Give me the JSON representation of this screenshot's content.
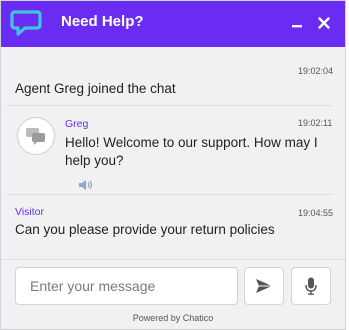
{
  "header": {
    "title": "Need Help?"
  },
  "chat": {
    "system_time": "19:02:04",
    "system_message": "Agent Greg joined the chat",
    "agent": {
      "name": "Greg",
      "time": "19:02:11",
      "message": "Hello! Welcome to our support. How may I help you?"
    },
    "visitor": {
      "name": "Visitor",
      "time": "19:04:55",
      "message": "Can you please provide your return policies"
    }
  },
  "footer": {
    "input_placeholder": "Enter your message",
    "powered_by": "Powered by Chatico"
  },
  "colors": {
    "brand": "#6a2cf3",
    "logo_accent": "#3ec6e0"
  },
  "icons": {
    "logo": "chat-bubble-logo-icon",
    "minimize": "minus-icon",
    "close": "close-icon",
    "agent_avatar": "chat-bubbles-icon",
    "audio": "speaker-icon",
    "send": "paper-plane-icon",
    "mic": "microphone-icon"
  }
}
